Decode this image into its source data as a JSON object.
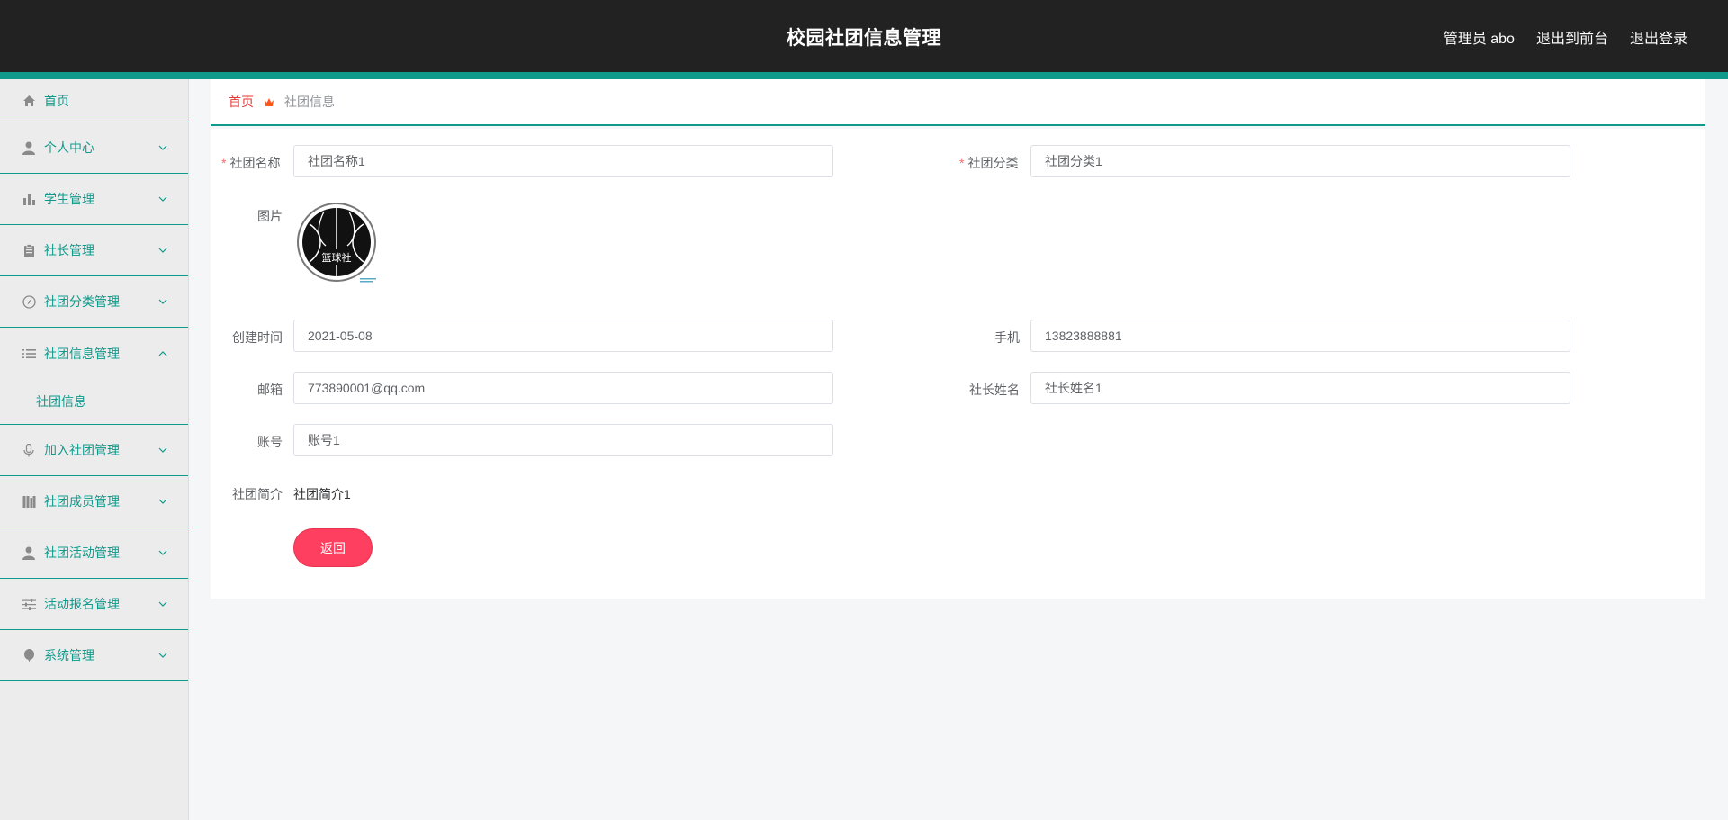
{
  "header": {
    "title": "校园社团信息管理",
    "admin": "管理员 abo",
    "to_front": "退出到前台",
    "logout": "退出登录"
  },
  "sidebar": {
    "items": [
      {
        "label": "首页",
        "icon": "home-icon"
      },
      {
        "label": "个人中心",
        "icon": "user-icon"
      },
      {
        "label": "学生管理",
        "icon": "bar-chart-icon"
      },
      {
        "label": "社长管理",
        "icon": "clipboard-icon"
      },
      {
        "label": "社团分类管理",
        "icon": "compass-icon"
      },
      {
        "label": "社团信息管理",
        "icon": "list-icon",
        "expanded": true,
        "children": [
          "社团信息"
        ]
      },
      {
        "label": "加入社团管理",
        "icon": "microphone-icon"
      },
      {
        "label": "社团成员管理",
        "icon": "books-icon"
      },
      {
        "label": "社团活动管理",
        "icon": "person-icon"
      },
      {
        "label": "活动报名管理",
        "icon": "sliders-icon"
      },
      {
        "label": "系统管理",
        "icon": "balloon-icon"
      }
    ]
  },
  "breadcrumb": {
    "home": "首页",
    "current": "社团信息"
  },
  "form": {
    "club_name": {
      "label": "社团名称",
      "required": true,
      "value": "社团名称1"
    },
    "club_category": {
      "label": "社团分类",
      "required": true,
      "value": "社团分类1"
    },
    "image": {
      "label": "图片",
      "logo_text": "篮球社"
    },
    "created": {
      "label": "创建时间",
      "value": "2021-05-08"
    },
    "phone": {
      "label": "手机",
      "value": "13823888881"
    },
    "email": {
      "label": "邮箱",
      "value": "773890001@qq.com"
    },
    "leader_name": {
      "label": "社长姓名",
      "value": "社长姓名1"
    },
    "account": {
      "label": "账号",
      "value": "账号1"
    },
    "intro": {
      "label": "社团简介",
      "value": "社团简介1"
    },
    "back_button": "返回"
  },
  "colors": {
    "accent": "#0f9a8c",
    "header_bg": "#222222",
    "danger": "#ff3f5f",
    "breadcrumb_home": "#e53935"
  }
}
